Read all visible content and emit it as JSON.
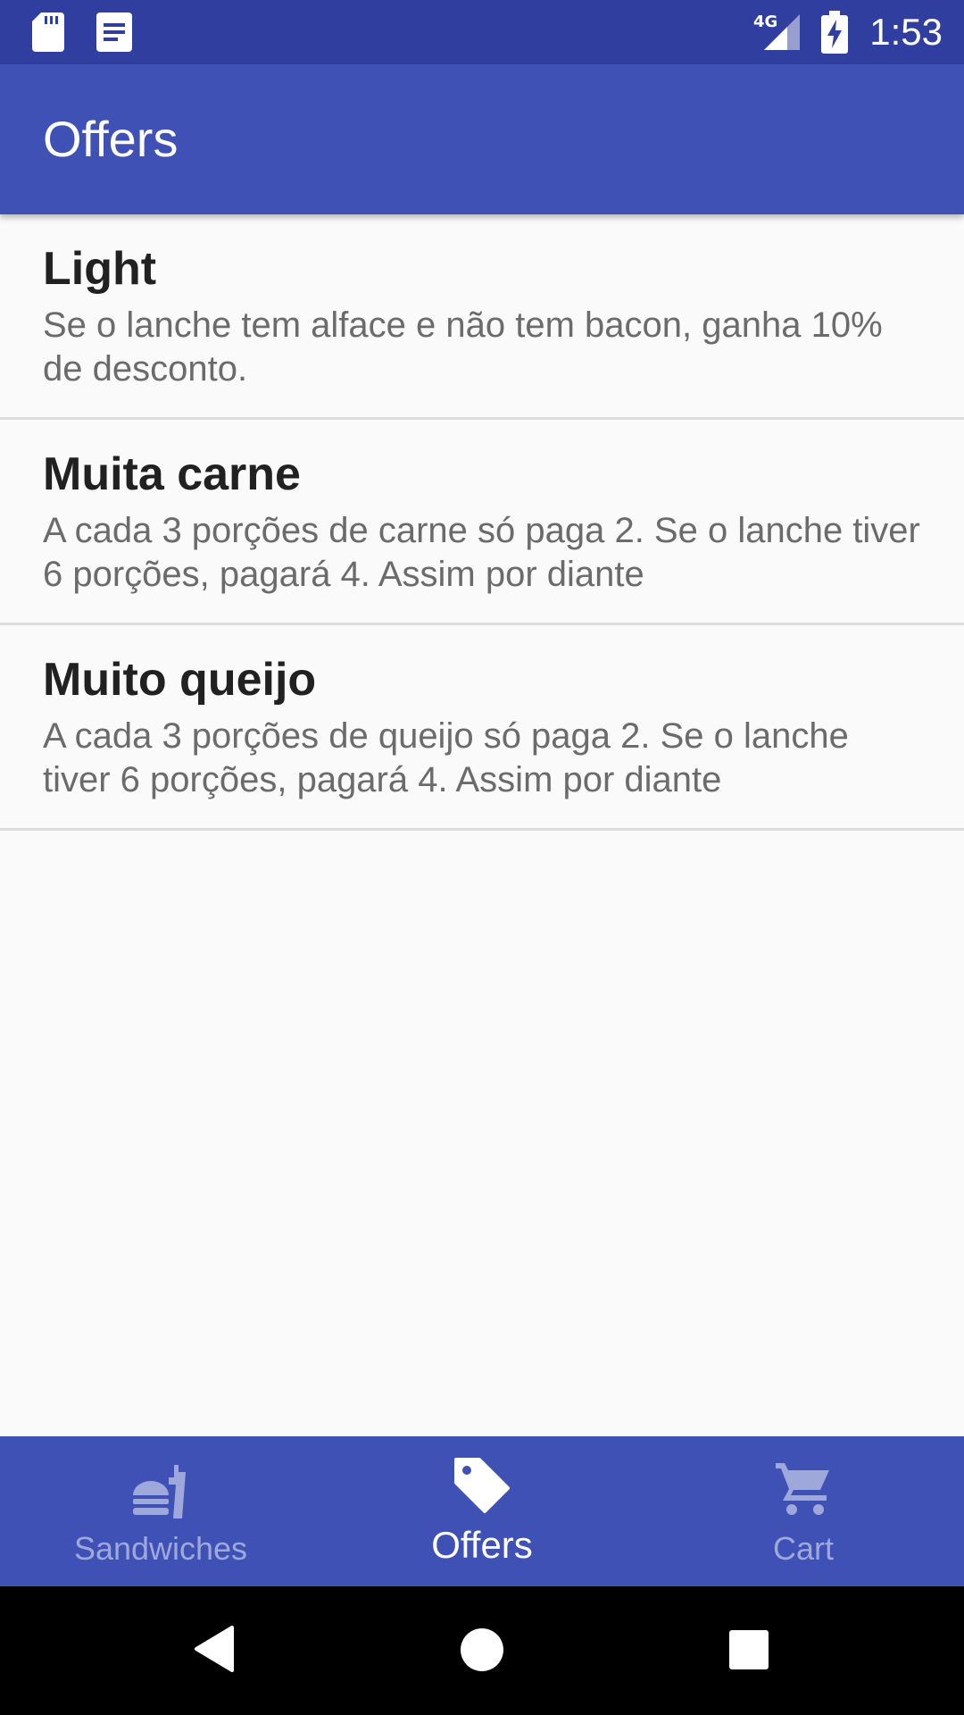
{
  "status_bar": {
    "time": "1:53",
    "network": "4G",
    "icons": [
      "sd-card-icon",
      "notification-icon",
      "signal-4g-icon",
      "battery-charging-icon"
    ]
  },
  "app_bar": {
    "title": "Offers"
  },
  "offers": [
    {
      "title": "Light",
      "description": "Se o lanche tem alface e não tem bacon, ganha 10% de desconto."
    },
    {
      "title": "Muita carne",
      "description": "A cada 3 porções de carne só paga 2. Se o lanche tiver 6 porções, pagará 4. Assim por diante"
    },
    {
      "title": "Muito queijo",
      "description": "A cada 3 porções de queijo só paga 2. Se o lanche tiver 6 porções, pagará 4. Assim por diante"
    }
  ],
  "bottom_nav": {
    "items": [
      {
        "label": "Sandwiches",
        "icon": "fastfood-icon",
        "active": false
      },
      {
        "label": "Offers",
        "icon": "tag-icon",
        "active": true
      },
      {
        "label": "Cart",
        "icon": "cart-icon",
        "active": false
      }
    ]
  },
  "system_nav": {
    "icons": [
      "back-icon",
      "home-icon",
      "recents-icon"
    ]
  },
  "colors": {
    "primary": "#3f51b5",
    "primary_dark": "#303f9f",
    "inactive_nav": "#9fa8da",
    "background": "#fafafa"
  }
}
